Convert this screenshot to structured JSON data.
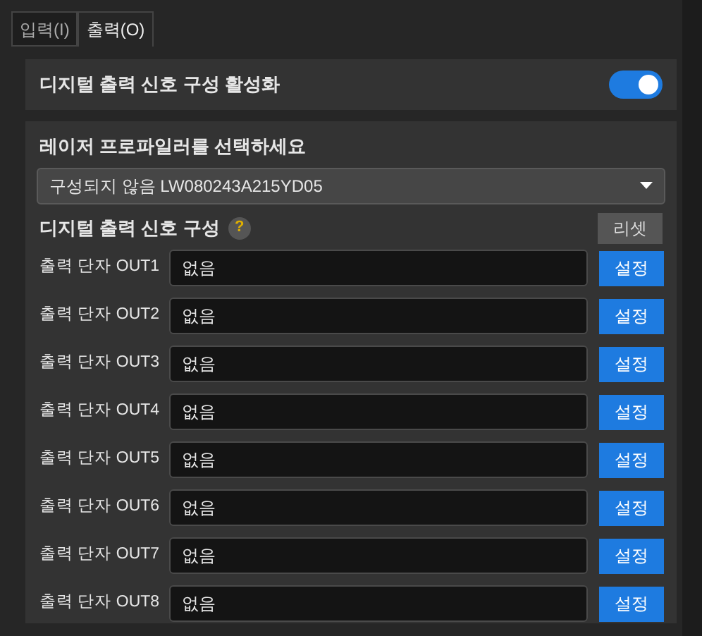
{
  "tabs": [
    {
      "label": "입력(I)",
      "selected": false
    },
    {
      "label": "출력(O)",
      "selected": true
    }
  ],
  "enable": {
    "label": "디지털 출력 신호 구성 활성화",
    "on": true
  },
  "profiler": {
    "label": "레이저 프로파일러를 선택하세요",
    "value": "구성되지 않음 LW080243A215YD05"
  },
  "config": {
    "label": "디지털 출력 신호 구성",
    "help": "?",
    "reset": "리셋"
  },
  "outputs": [
    {
      "label": "출력 단자 OUT1",
      "value": "없음",
      "button": "설정"
    },
    {
      "label": "출력 단자 OUT2",
      "value": "없음",
      "button": "설정"
    },
    {
      "label": "출력 단자 OUT3",
      "value": "없음",
      "button": "설정"
    },
    {
      "label": "출력 단자 OUT4",
      "value": "없음",
      "button": "설정"
    },
    {
      "label": "출력 단자 OUT5",
      "value": "없음",
      "button": "설정"
    },
    {
      "label": "출력 단자 OUT6",
      "value": "없음",
      "button": "설정"
    },
    {
      "label": "출력 단자 OUT7",
      "value": "없음",
      "button": "설정"
    },
    {
      "label": "출력 단자 OUT8",
      "value": "없음",
      "button": "설정"
    }
  ]
}
